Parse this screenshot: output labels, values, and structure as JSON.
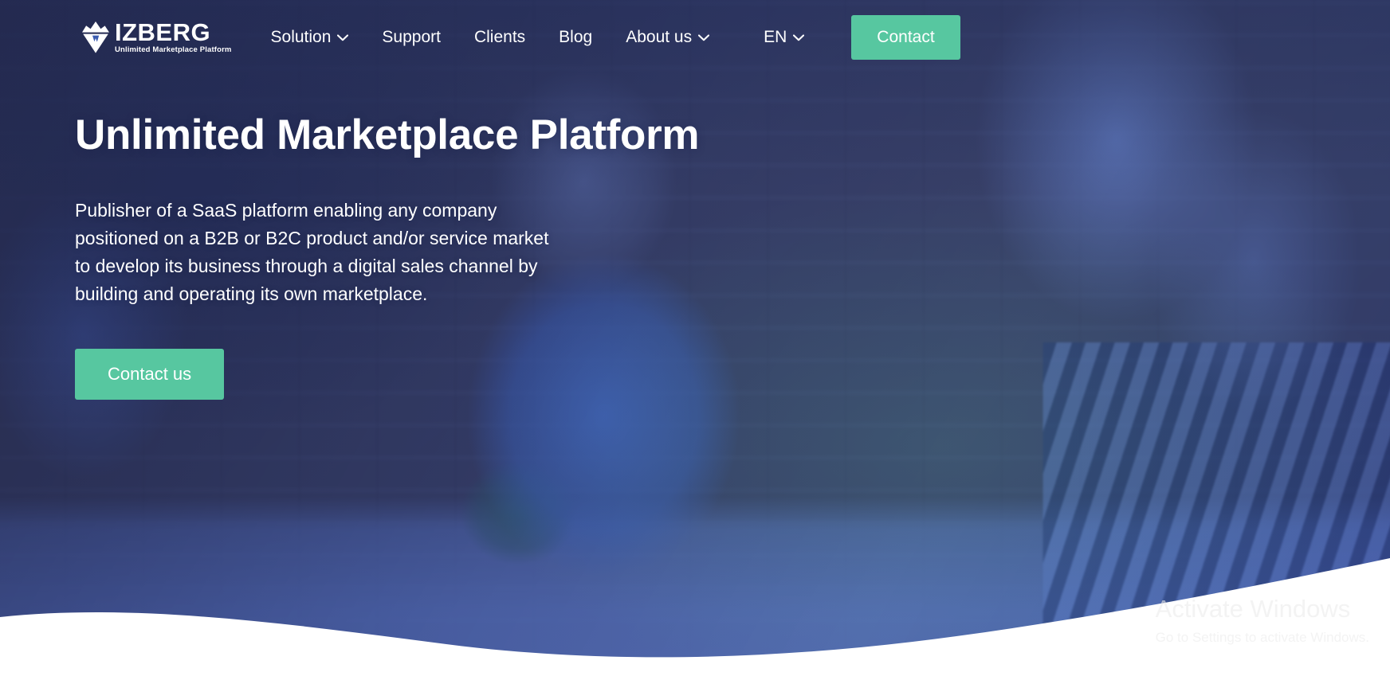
{
  "brand": {
    "logo_word": "IZBERG",
    "logo_tagline": "Unlimited Marketplace Platform",
    "logo_icon": "iceberg-icon",
    "accent_green": "#57c7a0",
    "deep_blue": "#2d3a70",
    "mid_blue": "#3a5bb0"
  },
  "nav": {
    "items": [
      {
        "label": "Solution",
        "has_dropdown": true,
        "icon": "chevron-down-icon"
      },
      {
        "label": "Support",
        "has_dropdown": false,
        "icon": ""
      },
      {
        "label": "Clients",
        "has_dropdown": false,
        "icon": ""
      },
      {
        "label": "Blog",
        "has_dropdown": false,
        "icon": ""
      },
      {
        "label": "About us",
        "has_dropdown": true,
        "icon": "chevron-down-icon"
      }
    ],
    "language": {
      "label": "EN",
      "icon": "chevron-down-icon"
    },
    "contact_button": "Contact"
  },
  "hero": {
    "title": "Unlimited Marketplace Platform",
    "subtitle": "Publisher of a SaaS platform enabling any company positioned on a B2B or B2C product and/or service market to develop its business through a digital sales channel by building and operating its own marketplace.",
    "cta_label": "Contact us"
  },
  "watermark": {
    "title": "Activate Windows",
    "subtitle": "Go to Settings to activate Windows."
  }
}
